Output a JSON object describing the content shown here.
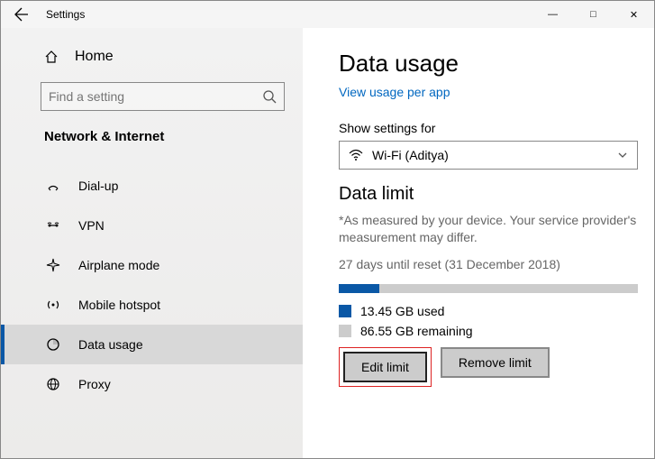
{
  "window": {
    "title": "Settings"
  },
  "winctrl": {
    "min": "—",
    "max": "□",
    "close": "✕"
  },
  "sidebar": {
    "home": "Home",
    "search_placeholder": "Find a setting",
    "section": "Network & Internet",
    "items": [
      {
        "label": "Dial-up"
      },
      {
        "label": "VPN"
      },
      {
        "label": "Airplane mode"
      },
      {
        "label": "Mobile hotspot"
      },
      {
        "label": "Data usage"
      },
      {
        "label": "Proxy"
      }
    ]
  },
  "main": {
    "title": "Data usage",
    "link": "View usage per app",
    "show_settings_label": "Show settings for",
    "network": "Wi-Fi (Aditya)",
    "limit_heading": "Data limit",
    "note": "*As measured by your device. Your service provider's measurement may differ.",
    "reset": "27 days until reset (31 December 2018)",
    "used": "13.45 GB used",
    "remaining": "86.55 GB remaining",
    "edit": "Edit limit",
    "remove": "Remove limit",
    "progress_pct": 13.45
  },
  "colors": {
    "accent": "#0a58a6",
    "link": "#0067c0",
    "highlight_border": "#d22"
  }
}
